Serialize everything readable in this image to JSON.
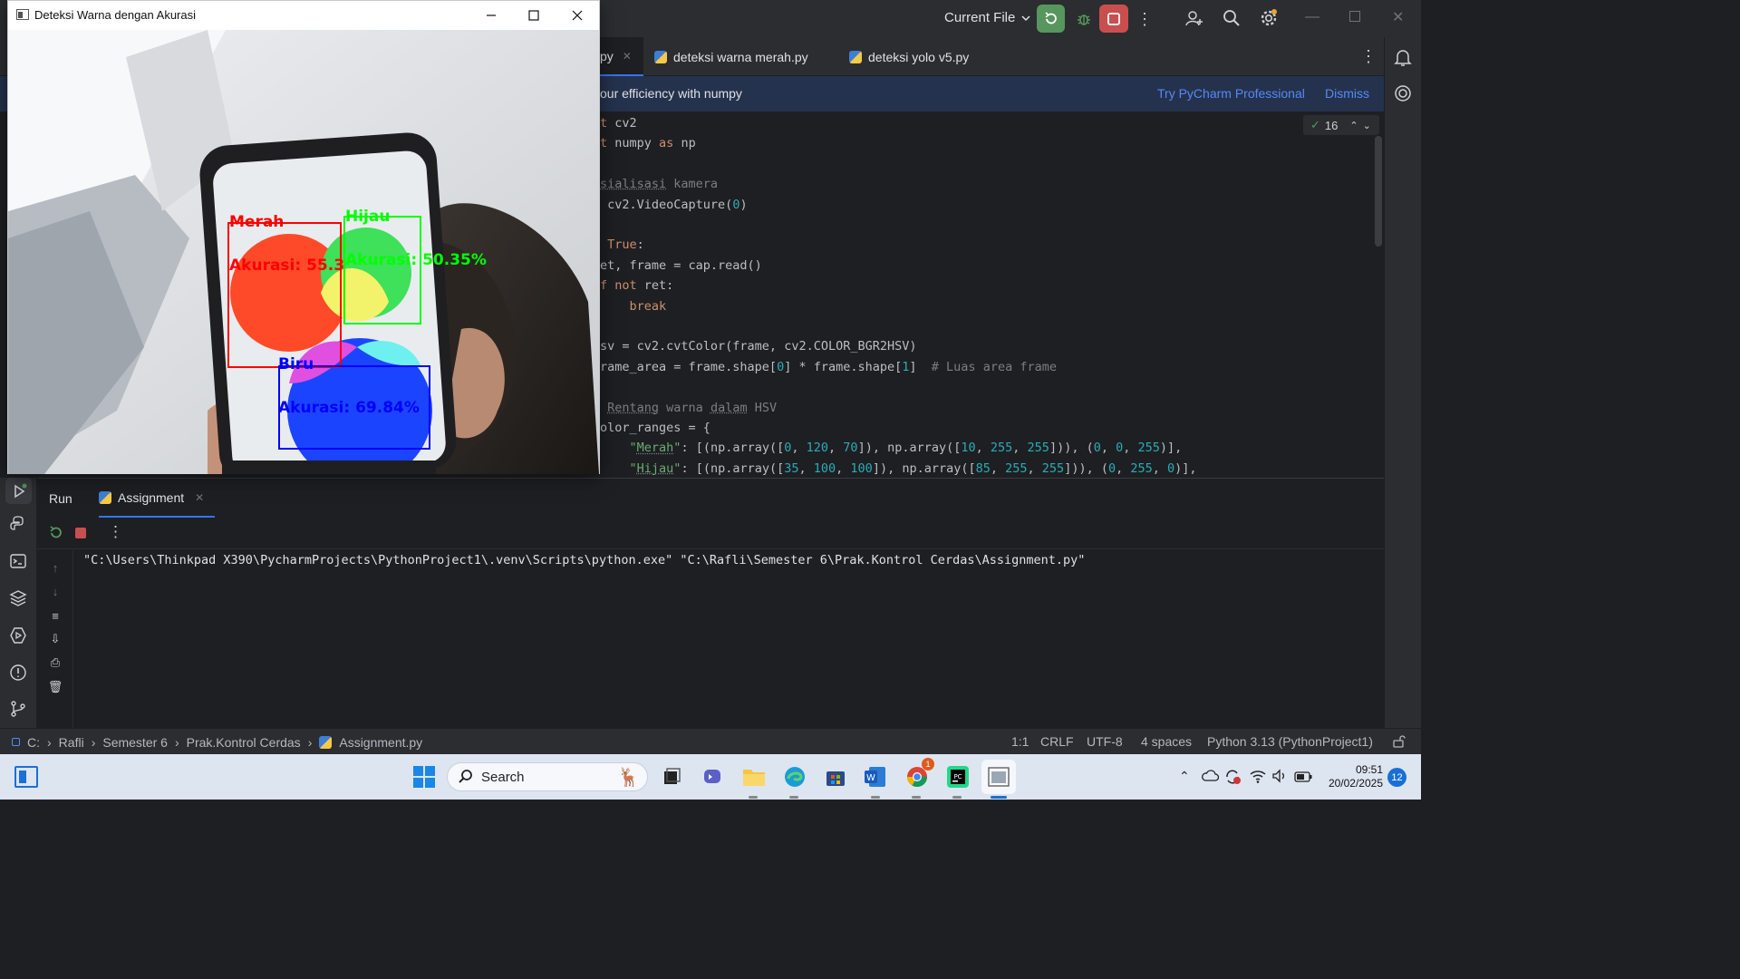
{
  "ide": {
    "run_config": "Current File",
    "tabs": [
      {
        "label": "py"
      },
      {
        "label": "deteksi warna merah.py"
      },
      {
        "label": "deteksi yolo v5.py"
      }
    ],
    "banner": {
      "text": "our efficiency with numpy",
      "action": "Try PyCharm Professional",
      "dismiss": "Dismiss"
    },
    "inspection_count": "16",
    "code_lines": [
      {
        "html": "<span class=\"kw\">t</span> cv2"
      },
      {
        "html": "<span class=\"kw\">t</span> numpy <span class=\"kw\">as</span> np"
      },
      {
        "html": ""
      },
      {
        "html": "<span class=\"cm\"><span class=\"und\">sialisasi</span> kamera</span>"
      },
      {
        "html": " cv2.VideoCapture(<span class=\"num\">0</span>)"
      },
      {
        "html": ""
      },
      {
        "html": " <span class=\"kw\">True</span>:"
      },
      {
        "html": "et, frame = cap.read()"
      },
      {
        "html": "<span class=\"kw\">f not</span> ret:"
      },
      {
        "html": "    <span class=\"kw\">break</span>"
      },
      {
        "html": ""
      },
      {
        "html": "sv = cv2.cvtColor(frame, cv2.COLOR_BGR2HSV)"
      },
      {
        "html": "rame_area = frame.shape[<span class=\"num\">0</span>] * frame.shape[<span class=\"num\">1</span>]  <span class=\"cm\"># Luas area frame</span>"
      },
      {
        "html": ""
      },
      {
        "html": " <span class=\"cm\"><span class=\"und\">Rentang</span> warna <span class=\"und\">dalam</span> HSV</span>"
      },
      {
        "html": "olor_ranges = {"
      },
      {
        "html": "    <span class=\"str\">\"<span class=\"und\">Merah</span>\"</span>: [(np.array([<span class=\"num\">0</span>, <span class=\"num\">120</span>, <span class=\"num\">70</span>]), np.array([<span class=\"num\">10</span>, <span class=\"num\">255</span>, <span class=\"num\">255</span>])), (<span class=\"num\">0</span>, <span class=\"num\">0</span>, <span class=\"num\">255</span>)],"
      },
      {
        "html": "    <span class=\"str\">\"<span class=\"und\">Hijau</span>\"</span>: [(np.array([<span class=\"num\">35</span>, <span class=\"num\">100</span>, <span class=\"num\">100</span>]), np.array([<span class=\"num\">85</span>, <span class=\"num\">255</span>, <span class=\"num\">255</span>])), (<span class=\"num\">0</span>, <span class=\"num\">255</span>, <span class=\"num\">0</span>)],"
      }
    ],
    "run_panel": {
      "run_label": "Run",
      "tab_label": "Assignment",
      "console_line": "\"C:\\Users\\Thinkpad X390\\PycharmProjects\\PythonProject1\\.venv\\Scripts\\python.exe\" \"C:\\Rafli\\Semester 6\\Prak.Kontrol Cerdas\\Assignment.py\""
    },
    "breadcrumb": [
      "C:",
      "Rafli",
      "Semester 6",
      "Prak.Kontrol Cerdas",
      "Assignment.py"
    ],
    "status": {
      "position": "1:1",
      "line_sep": "CRLF",
      "encoding": "UTF-8",
      "indent": "4 spaces",
      "interpreter": "Python 3.13 (PythonProject1)"
    }
  },
  "window": {
    "title": "Deteksi Warna dengan Akurasi",
    "detections": [
      {
        "name": "Merah",
        "accuracy": "Akurasi: 55.3",
        "color": "#ff0000"
      },
      {
        "name": "Hijau",
        "accuracy": "Akurasi: 50.35%",
        "color": "#00ff00"
      },
      {
        "name": "Biru",
        "accuracy": "Akurasi: 69.84%",
        "color": "#0000ff"
      }
    ]
  },
  "taskbar": {
    "search_placeholder": "Search",
    "time": "09:51",
    "date": "20/02/2025",
    "notification_count": "12",
    "chrome_badge": "1"
  }
}
